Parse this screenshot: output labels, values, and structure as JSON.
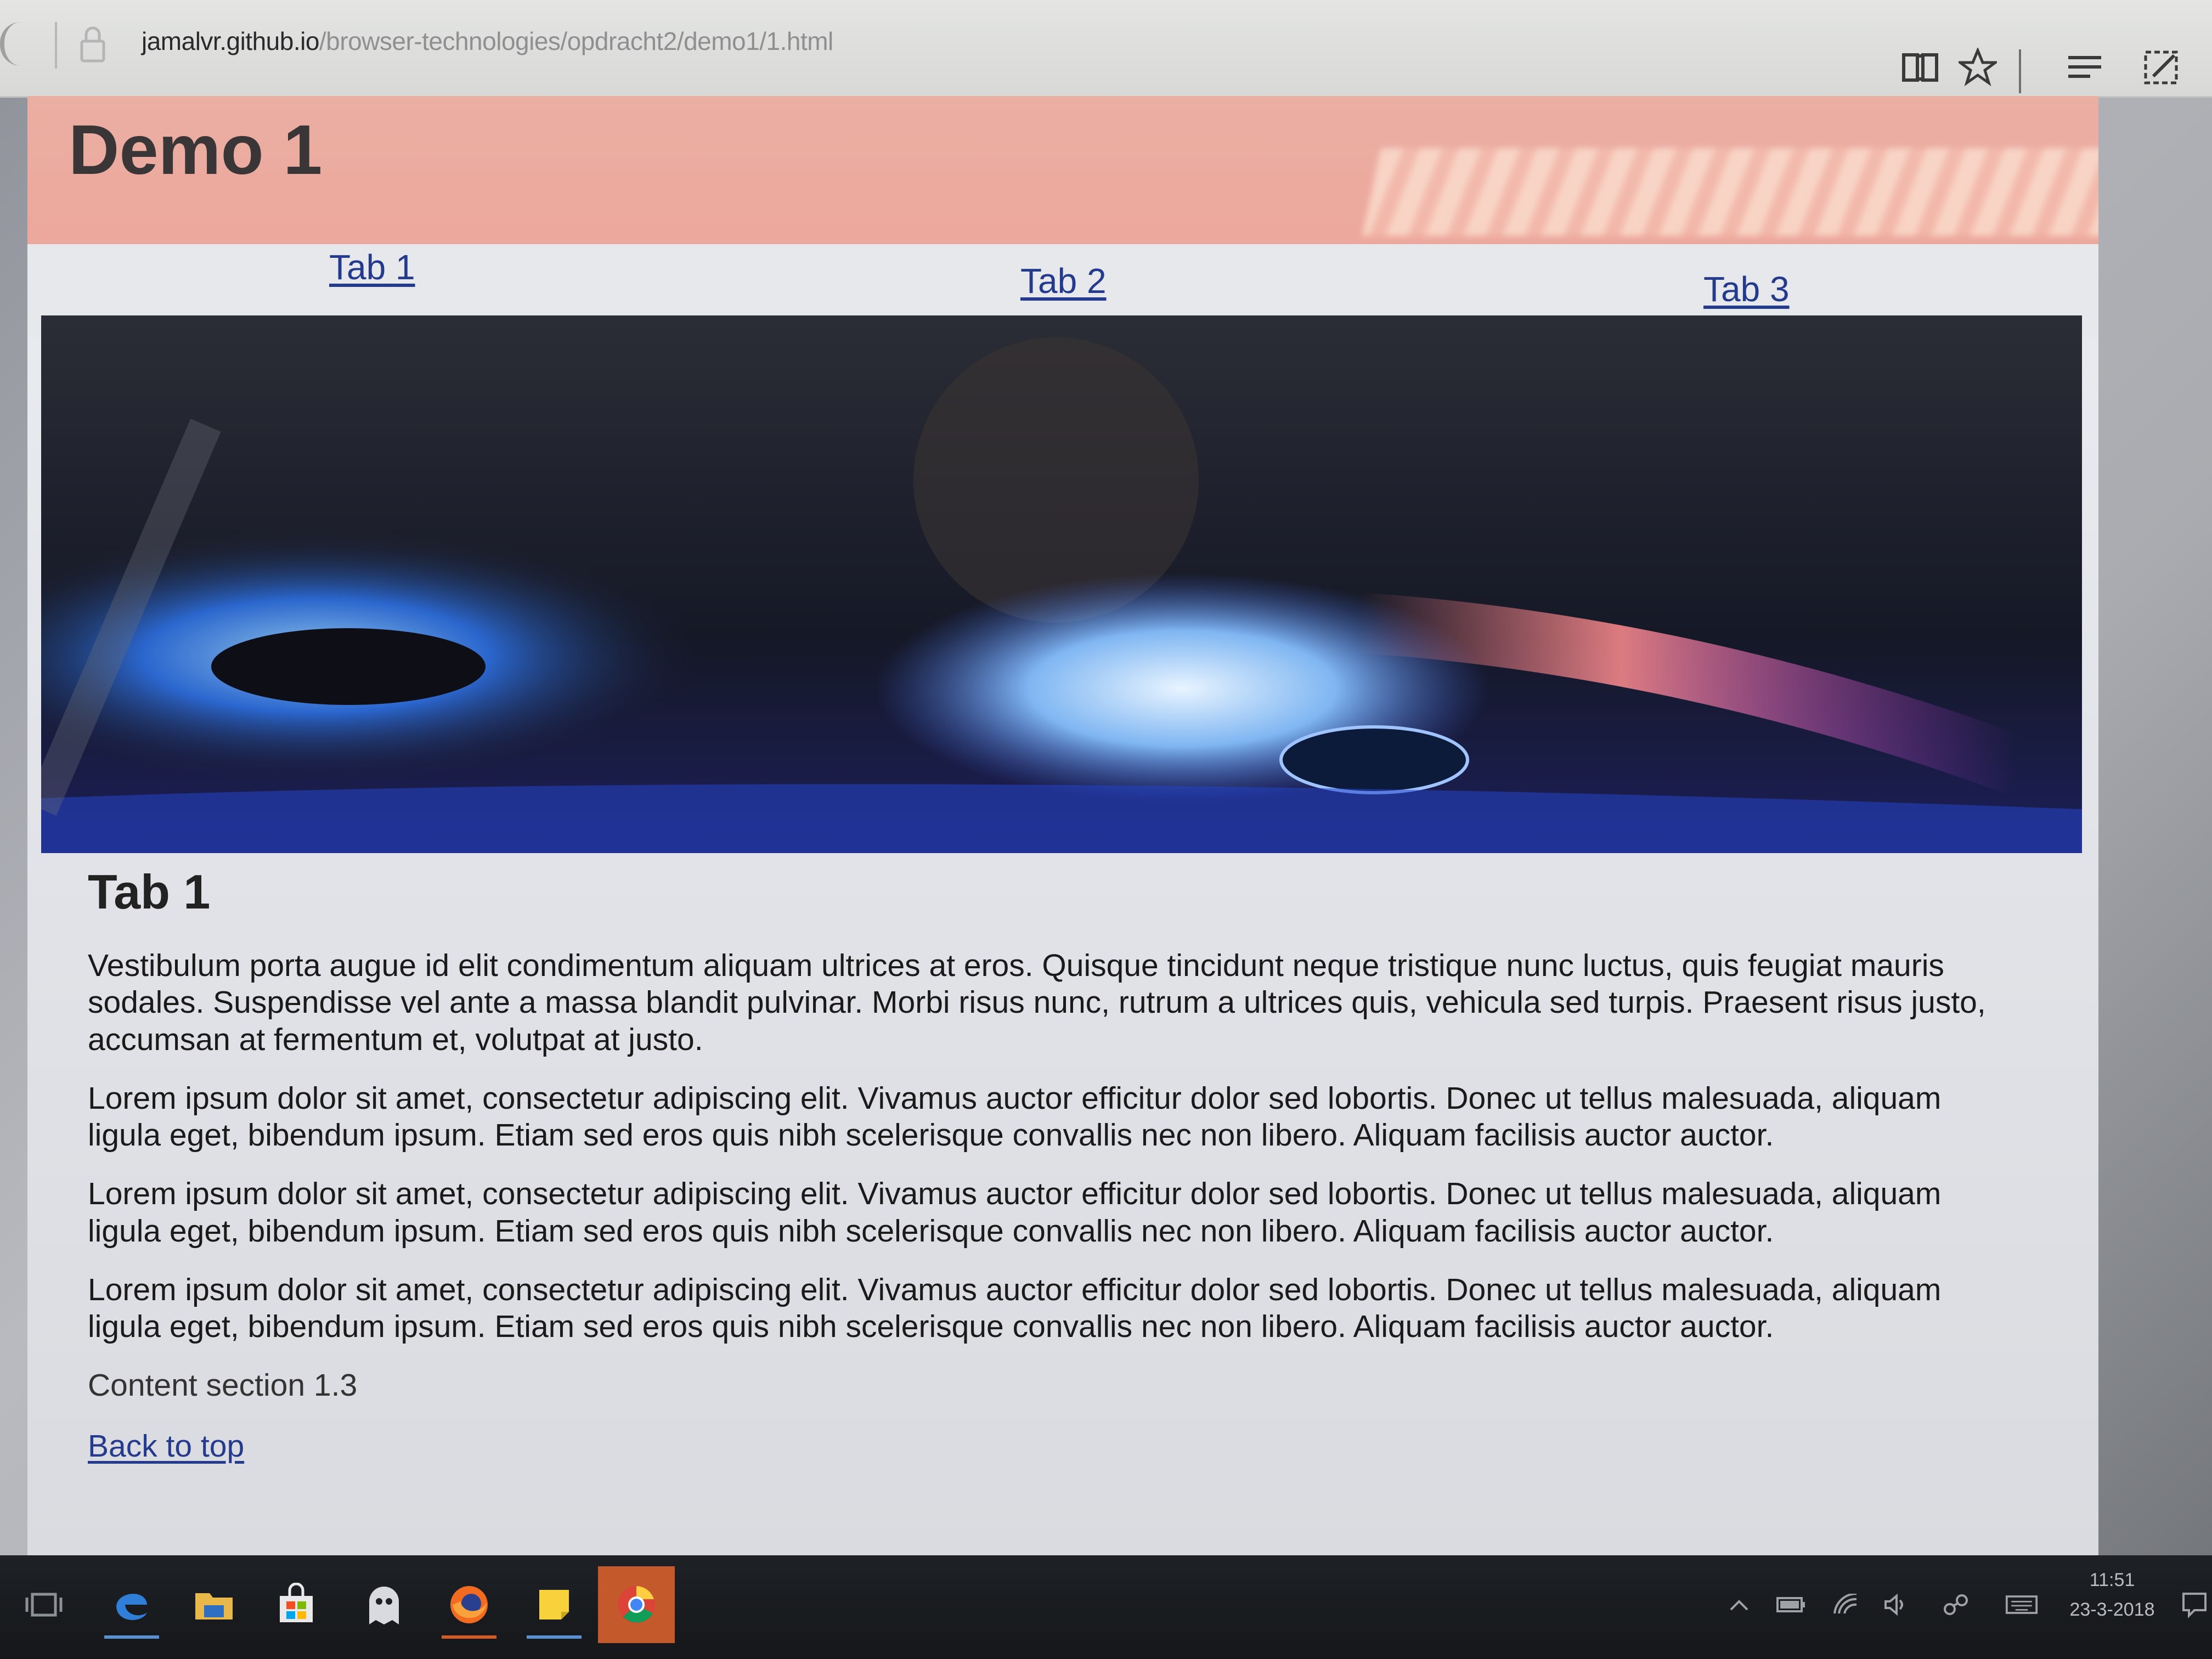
{
  "browser": {
    "url_host": "jamalvr.github.io",
    "url_path": "/browser-technologies/opdracht2/demo1/1.html",
    "icons": [
      "back-icon",
      "lock-icon",
      "reading-view-icon",
      "favorite-star-icon",
      "hub-icon",
      "web-note-icon"
    ]
  },
  "page": {
    "title": "Demo 1",
    "tabs": [
      {
        "label": "Tab 1"
      },
      {
        "label": "Tab 2"
      },
      {
        "label": "Tab 3"
      }
    ],
    "content": {
      "heading": "Tab 1",
      "paragraphs": [
        "Vestibulum porta augue id elit condimentum aliquam ultrices at eros. Quisque tincidunt neque tristique nunc luctus, quis feugiat mauris sodales. Suspendisse vel ante a massa blandit pulvinar. Morbi risus nunc, rutrum a ultrices quis, vehicula sed turpis. Praesent risus justo, accumsan at fermentum et, volutpat at justo.",
        "Lorem ipsum dolor sit amet, consectetur adipiscing elit. Vivamus auctor efficitur dolor sed lobortis. Donec ut tellus malesuada, aliquam ligula eget, bibendum ipsum. Etiam sed eros quis nibh scelerisque convallis nec non libero. Aliquam facilisis auctor auctor.",
        "Lorem ipsum dolor sit amet, consectetur adipiscing elit. Vivamus auctor efficitur dolor sed lobortis. Donec ut tellus malesuada, aliquam ligula eget, bibendum ipsum. Etiam sed eros quis nibh scelerisque convallis nec non libero. Aliquam facilisis auctor auctor.",
        "Lorem ipsum dolor sit amet, consectetur adipiscing elit. Vivamus auctor efficitur dolor sed lobortis. Donec ut tellus malesuada, aliquam ligula eget, bibendum ipsum. Etiam sed eros quis nibh scelerisque convallis nec non libero. Aliquam facilisis auctor auctor."
      ],
      "section_caption": "Content section 1.3",
      "back_to_top": "Back to top"
    },
    "colors": {
      "header_bg": "#eca79b",
      "link": "#243a8c",
      "page_bg": "#e7e8ec"
    }
  },
  "taskbar": {
    "apps": [
      "task-view-icon",
      "edge-icon",
      "file-explorer-icon",
      "store-icon",
      "ghost-app-icon",
      "firefox-icon",
      "sticky-notes-icon",
      "chrome-icon"
    ],
    "tray": [
      "show-hidden-icons-icon",
      "battery-icon",
      "wifi-icon",
      "volume-icon",
      "network-icon",
      "keyboard-icon",
      "notifications-icon"
    ],
    "time": "11:51",
    "date": "23-3-2018"
  }
}
